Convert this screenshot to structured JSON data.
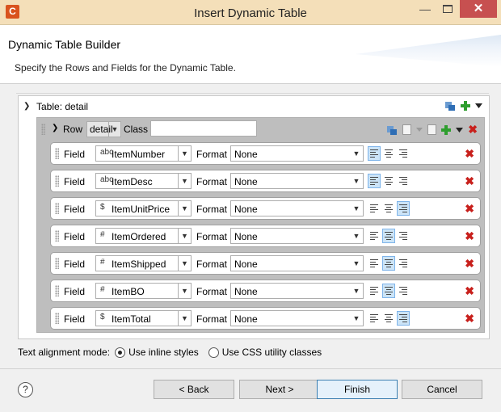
{
  "window": {
    "title": "Insert Dynamic Table",
    "app_icon_letter": "C",
    "min": "—",
    "close": "✕"
  },
  "banner": {
    "title": "Dynamic Table Builder",
    "description": "Specify the Rows and Fields for the Dynamic Table."
  },
  "table": {
    "label": "Table: detail"
  },
  "row": {
    "label": "Row",
    "selected": "detail",
    "class_label": "Class",
    "class_value": ""
  },
  "fields": [
    {
      "label": "Field",
      "type_icon": "abc",
      "name": "ItemNumber",
      "format_label": "Format",
      "format": "None",
      "align": "left"
    },
    {
      "label": "Field",
      "type_icon": "abc",
      "name": "ItemDesc",
      "format_label": "Format",
      "format": "None",
      "align": "left"
    },
    {
      "label": "Field",
      "type_icon": "$",
      "name": "ItemUnitPrice",
      "format_label": "Format",
      "format": "None",
      "align": "right"
    },
    {
      "label": "Field",
      "type_icon": "#",
      "name": "ItemOrdered",
      "format_label": "Format",
      "format": "None",
      "align": "center"
    },
    {
      "label": "Field",
      "type_icon": "#",
      "name": "ItemShipped",
      "format_label": "Format",
      "format": "None",
      "align": "center"
    },
    {
      "label": "Field",
      "type_icon": "#",
      "name": "ItemBO",
      "format_label": "Format",
      "format": "None",
      "align": "center"
    },
    {
      "label": "Field",
      "type_icon": "$",
      "name": "ItemTotal",
      "format_label": "Format",
      "format": "None",
      "align": "right"
    }
  ],
  "mode": {
    "label": "Text alignment mode:",
    "option_inline": "Use inline styles",
    "option_css": "Use CSS utility classes",
    "selected": "inline"
  },
  "buttons": {
    "help": "?",
    "back": "< Back",
    "next": "Next >",
    "finish": "Finish",
    "cancel": "Cancel"
  },
  "colors": {
    "title_bar": "#f4dfb9",
    "close": "#c75050",
    "delete": "#c8201c",
    "active_align": "#cce4f7",
    "add": "#2e9e2e"
  }
}
